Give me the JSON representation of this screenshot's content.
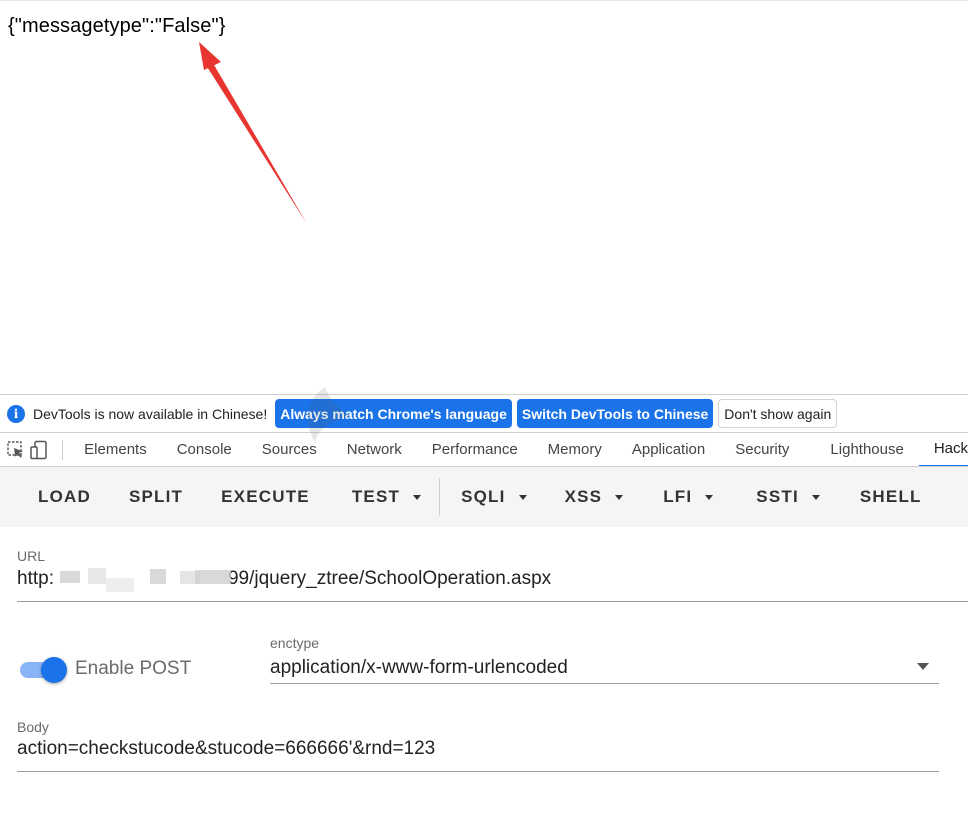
{
  "page": {
    "response_text": "{\"messagetype\":\"False\"}"
  },
  "infobar": {
    "message": "DevTools is now available in Chinese!",
    "btn_match": "Always match Chrome's language",
    "btn_switch": "Switch DevTools to Chinese",
    "btn_dismiss": "Don't show again"
  },
  "devtools_tabs": [
    "Elements",
    "Console",
    "Sources",
    "Network",
    "Performance",
    "Memory",
    "Application",
    "Security",
    "Lighthouse",
    "Hack"
  ],
  "active_tab": "Hack",
  "hackbar": {
    "buttons": {
      "load": "LOAD",
      "split": "SPLIT",
      "execute": "EXECUTE",
      "test": "TEST",
      "sqli": "SQLI",
      "xss": "XSS",
      "lfi": "LFI",
      "ssti": "SSTI",
      "shell": "SHELL"
    },
    "url_label": "URL",
    "url_prefix": "http:",
    "url_suffix": "99/jquery_ztree/SchoolOperation.aspx",
    "enable_post_label": "Enable POST",
    "enable_post": true,
    "enctype_label": "enctype",
    "enctype_value": "application/x-www-form-urlencoded",
    "body_label": "Body",
    "body_value": "action=checkstucode&stucode=666666'&rnd=123"
  },
  "colors": {
    "accent": "#1a73e8",
    "arrow": "#e8352f"
  },
  "icons": [
    "inspect-element-icon",
    "device-toolbar-icon",
    "info-icon",
    "dropdown-caret-icon"
  ]
}
